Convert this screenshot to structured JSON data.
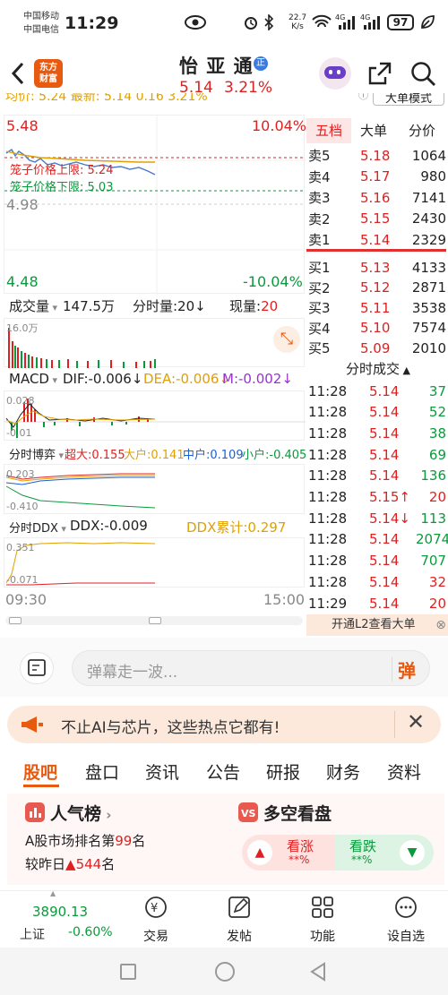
{
  "status_bar": {
    "carrier1": "中国移动",
    "carrier2": "中国电信",
    "time": "11:29",
    "net_speed_top": "22.7",
    "net_speed_unit": "K/s",
    "battery": "97"
  },
  "header": {
    "logo_line1": "东方",
    "logo_line2": "财富",
    "stock_name": "怡 亚 通",
    "badge": "正",
    "price": "5.14",
    "change_pct": "3.21%"
  },
  "chart": {
    "info_bar": "均价: 5.24 最新: 5.14 0.16 3.21%",
    "mode_button": "大单模式",
    "price_high": "5.48",
    "price_mid": "4.98",
    "price_low": "4.48",
    "pct_high": "10.04%",
    "pct_low": "-10.04%",
    "limit_up_label": "笼子价格上限:",
    "limit_up_value": "5.24",
    "limit_down_label": "笼子价格下限:",
    "limit_down_value": "5.03",
    "volume_tab": "成交量",
    "volume_value": "147.5万",
    "minute_volume_label": "分时量:20",
    "current_volume_label": "现量:",
    "current_volume_value": "20",
    "volume_axis": "16.0万",
    "macd_tab": "MACD",
    "macd_dif": "DIF:-0.006↓",
    "macd_dea": "DEA:-0.006↓",
    "macd_m": "M:-0.002↓",
    "macd_axis_top": "0.028",
    "macd_axis_bottom": "-0.01",
    "game_tab": "分时博弈",
    "game_super": "超大:0.155",
    "game_large": "大户:0.141",
    "game_mid": "中户:0.109",
    "game_small": "小户:-0.405",
    "game_axis_top": "0.203",
    "game_axis_bottom": "-0.410",
    "ddx_tab": "分时DDX",
    "ddx_value": "DDX:-0.009",
    "ddx_total": "DDX累计:0.297",
    "ddx_axis_top": "0.351",
    "ddx_axis_bottom": "-0.071",
    "time_start": "09:30",
    "time_end": "15:00"
  },
  "order_book": {
    "tabs": [
      "五档",
      "大单",
      "分价"
    ],
    "asks": [
      {
        "label": "卖5",
        "price": "5.18",
        "vol": "1064"
      },
      {
        "label": "卖4",
        "price": "5.17",
        "vol": "980"
      },
      {
        "label": "卖3",
        "price": "5.16",
        "vol": "7141"
      },
      {
        "label": "卖2",
        "price": "5.15",
        "vol": "2430"
      },
      {
        "label": "卖1",
        "price": "5.14",
        "vol": "2329"
      }
    ],
    "bids": [
      {
        "label": "买1",
        "price": "5.13",
        "vol": "4133"
      },
      {
        "label": "买2",
        "price": "5.12",
        "vol": "2871"
      },
      {
        "label": "买3",
        "price": "5.11",
        "vol": "3538"
      },
      {
        "label": "买4",
        "price": "5.10",
        "vol": "7574"
      },
      {
        "label": "买5",
        "price": "5.09",
        "vol": "2010"
      }
    ],
    "trades_title": "分时成交",
    "trades": [
      {
        "time": "11:28",
        "price": "5.14",
        "vol": "37",
        "color": "green"
      },
      {
        "time": "11:28",
        "price": "5.14",
        "vol": "52",
        "color": "green"
      },
      {
        "time": "11:28",
        "price": "5.14",
        "vol": "38",
        "color": "green"
      },
      {
        "time": "11:28",
        "price": "5.14",
        "vol": "69",
        "color": "green"
      },
      {
        "time": "11:28",
        "price": "5.14",
        "vol": "136",
        "color": "green"
      },
      {
        "time": "11:28",
        "price": "5.15↑",
        "vol": "20",
        "color": "red"
      },
      {
        "time": "11:28",
        "price": "5.14↓",
        "vol": "113",
        "color": "green"
      },
      {
        "time": "11:28",
        "price": "5.14",
        "vol": "2074",
        "color": "green"
      },
      {
        "time": "11:28",
        "price": "5.14",
        "vol": "707",
        "color": "green"
      },
      {
        "time": "11:28",
        "price": "5.14",
        "vol": "32",
        "color": "red"
      },
      {
        "time": "11:29",
        "price": "5.14",
        "vol": "20",
        "color": "red"
      }
    ],
    "l2_banner": "开通L2查看大单"
  },
  "comment": {
    "placeholder": "弹幕走一波...",
    "danmu_button": "弹"
  },
  "promo": {
    "text": "不止AI与芯片，这些热点它都有!"
  },
  "tabs": [
    "股吧",
    "盘口",
    "资讯",
    "公告",
    "研报",
    "财务",
    "资料"
  ],
  "cards": {
    "popularity_title": "人气榜",
    "popularity_line1_prefix": "A股市场排名第",
    "popularity_rank": "99",
    "popularity_line1_suffix": "名",
    "popularity_line2_prefix": "较昨日",
    "popularity_change": "544",
    "popularity_line2_suffix": "名",
    "longshort_title": "多空看盘",
    "bull_label": "看涨",
    "bull_pct": "**%",
    "bear_label": "看跌",
    "bear_pct": "**%"
  },
  "bottom_nav": {
    "index_value": "3890.13",
    "index_name": "上证",
    "index_change": "-0.60%",
    "items": [
      "交易",
      "发帖",
      "功能",
      "设自选"
    ]
  },
  "colors": {
    "up": "#e02020",
    "down": "#0a9a3c",
    "brand": "#e85a10"
  }
}
